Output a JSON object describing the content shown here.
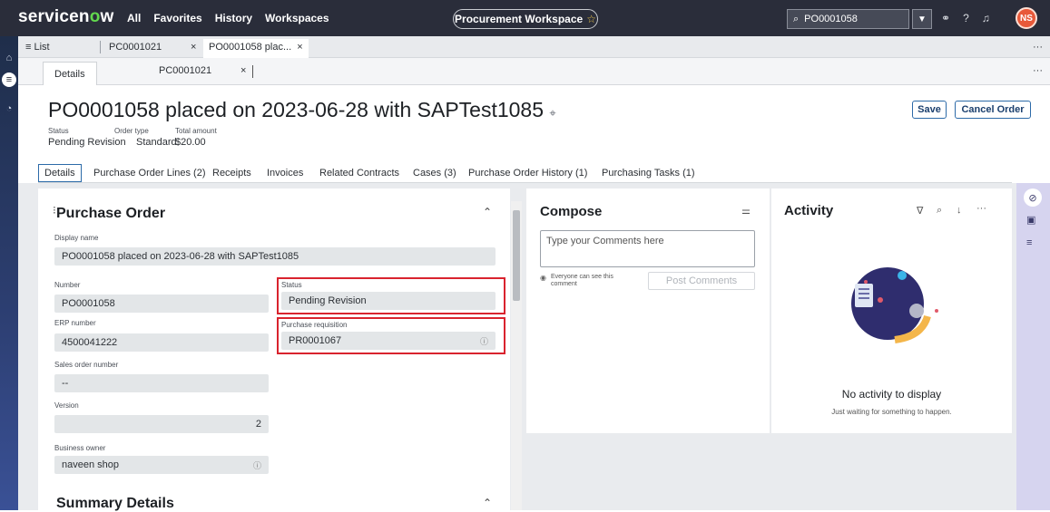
{
  "topbar": {
    "logo_pre": "servicen",
    "logo_o": "o",
    "logo_post": "w",
    "nav": [
      "All",
      "Favorites",
      "History",
      "Workspaces"
    ],
    "workspace": "Procurement Workspace",
    "search_value": "PO0001058",
    "avatar": "NS"
  },
  "tabs1": {
    "list": "≡ List",
    "tab_a": "PC0001021",
    "tab_b": "PO0001058 plac...",
    "close": "×"
  },
  "tabs2": {
    "details": "Details",
    "pc": "PC0001021",
    "close": "×"
  },
  "record": {
    "title": "PO0001058 placed on 2023-06-28 with SAPTest1085",
    "status_label": "Status",
    "status_value": "Pending Revision",
    "ordertype_label": "Order type",
    "ordertype_value": "Standard",
    "total_label": "Total amount",
    "total_value": "$20.00"
  },
  "actions": {
    "save": "Save",
    "cancel": "Cancel Order"
  },
  "form_tabs": [
    "Details",
    "Purchase Order Lines (2)",
    "Receipts",
    "Invoices",
    "Related Contracts",
    "Cases (3)",
    "Purchase Order History (1)",
    "Purchasing Tasks (1)"
  ],
  "form": {
    "section": "Purchase Order",
    "display_name_label": "Display name",
    "display_name": "PO0001058 placed on 2023-06-28 with SAPTest1085",
    "number_label": "Number",
    "number": "PO0001058",
    "status_label": "Status",
    "status": "Pending Revision",
    "erp_label": "ERP number",
    "erp": "4500041222",
    "preq_label": "Purchase requisition",
    "preq": "PR0001067",
    "sales_label": "Sales order number",
    "sales": "--",
    "version_label": "Version",
    "version": "2",
    "owner_label": "Business owner",
    "owner": "naveen shop",
    "summary": "Summary Details"
  },
  "compose": {
    "title": "Compose",
    "placeholder": "Type your Comments here",
    "visibility": "Everyone can see this comment",
    "post": "Post Comments"
  },
  "activity": {
    "title": "Activity",
    "empty": "No activity to display",
    "sub": "Just waiting for something to happen."
  }
}
